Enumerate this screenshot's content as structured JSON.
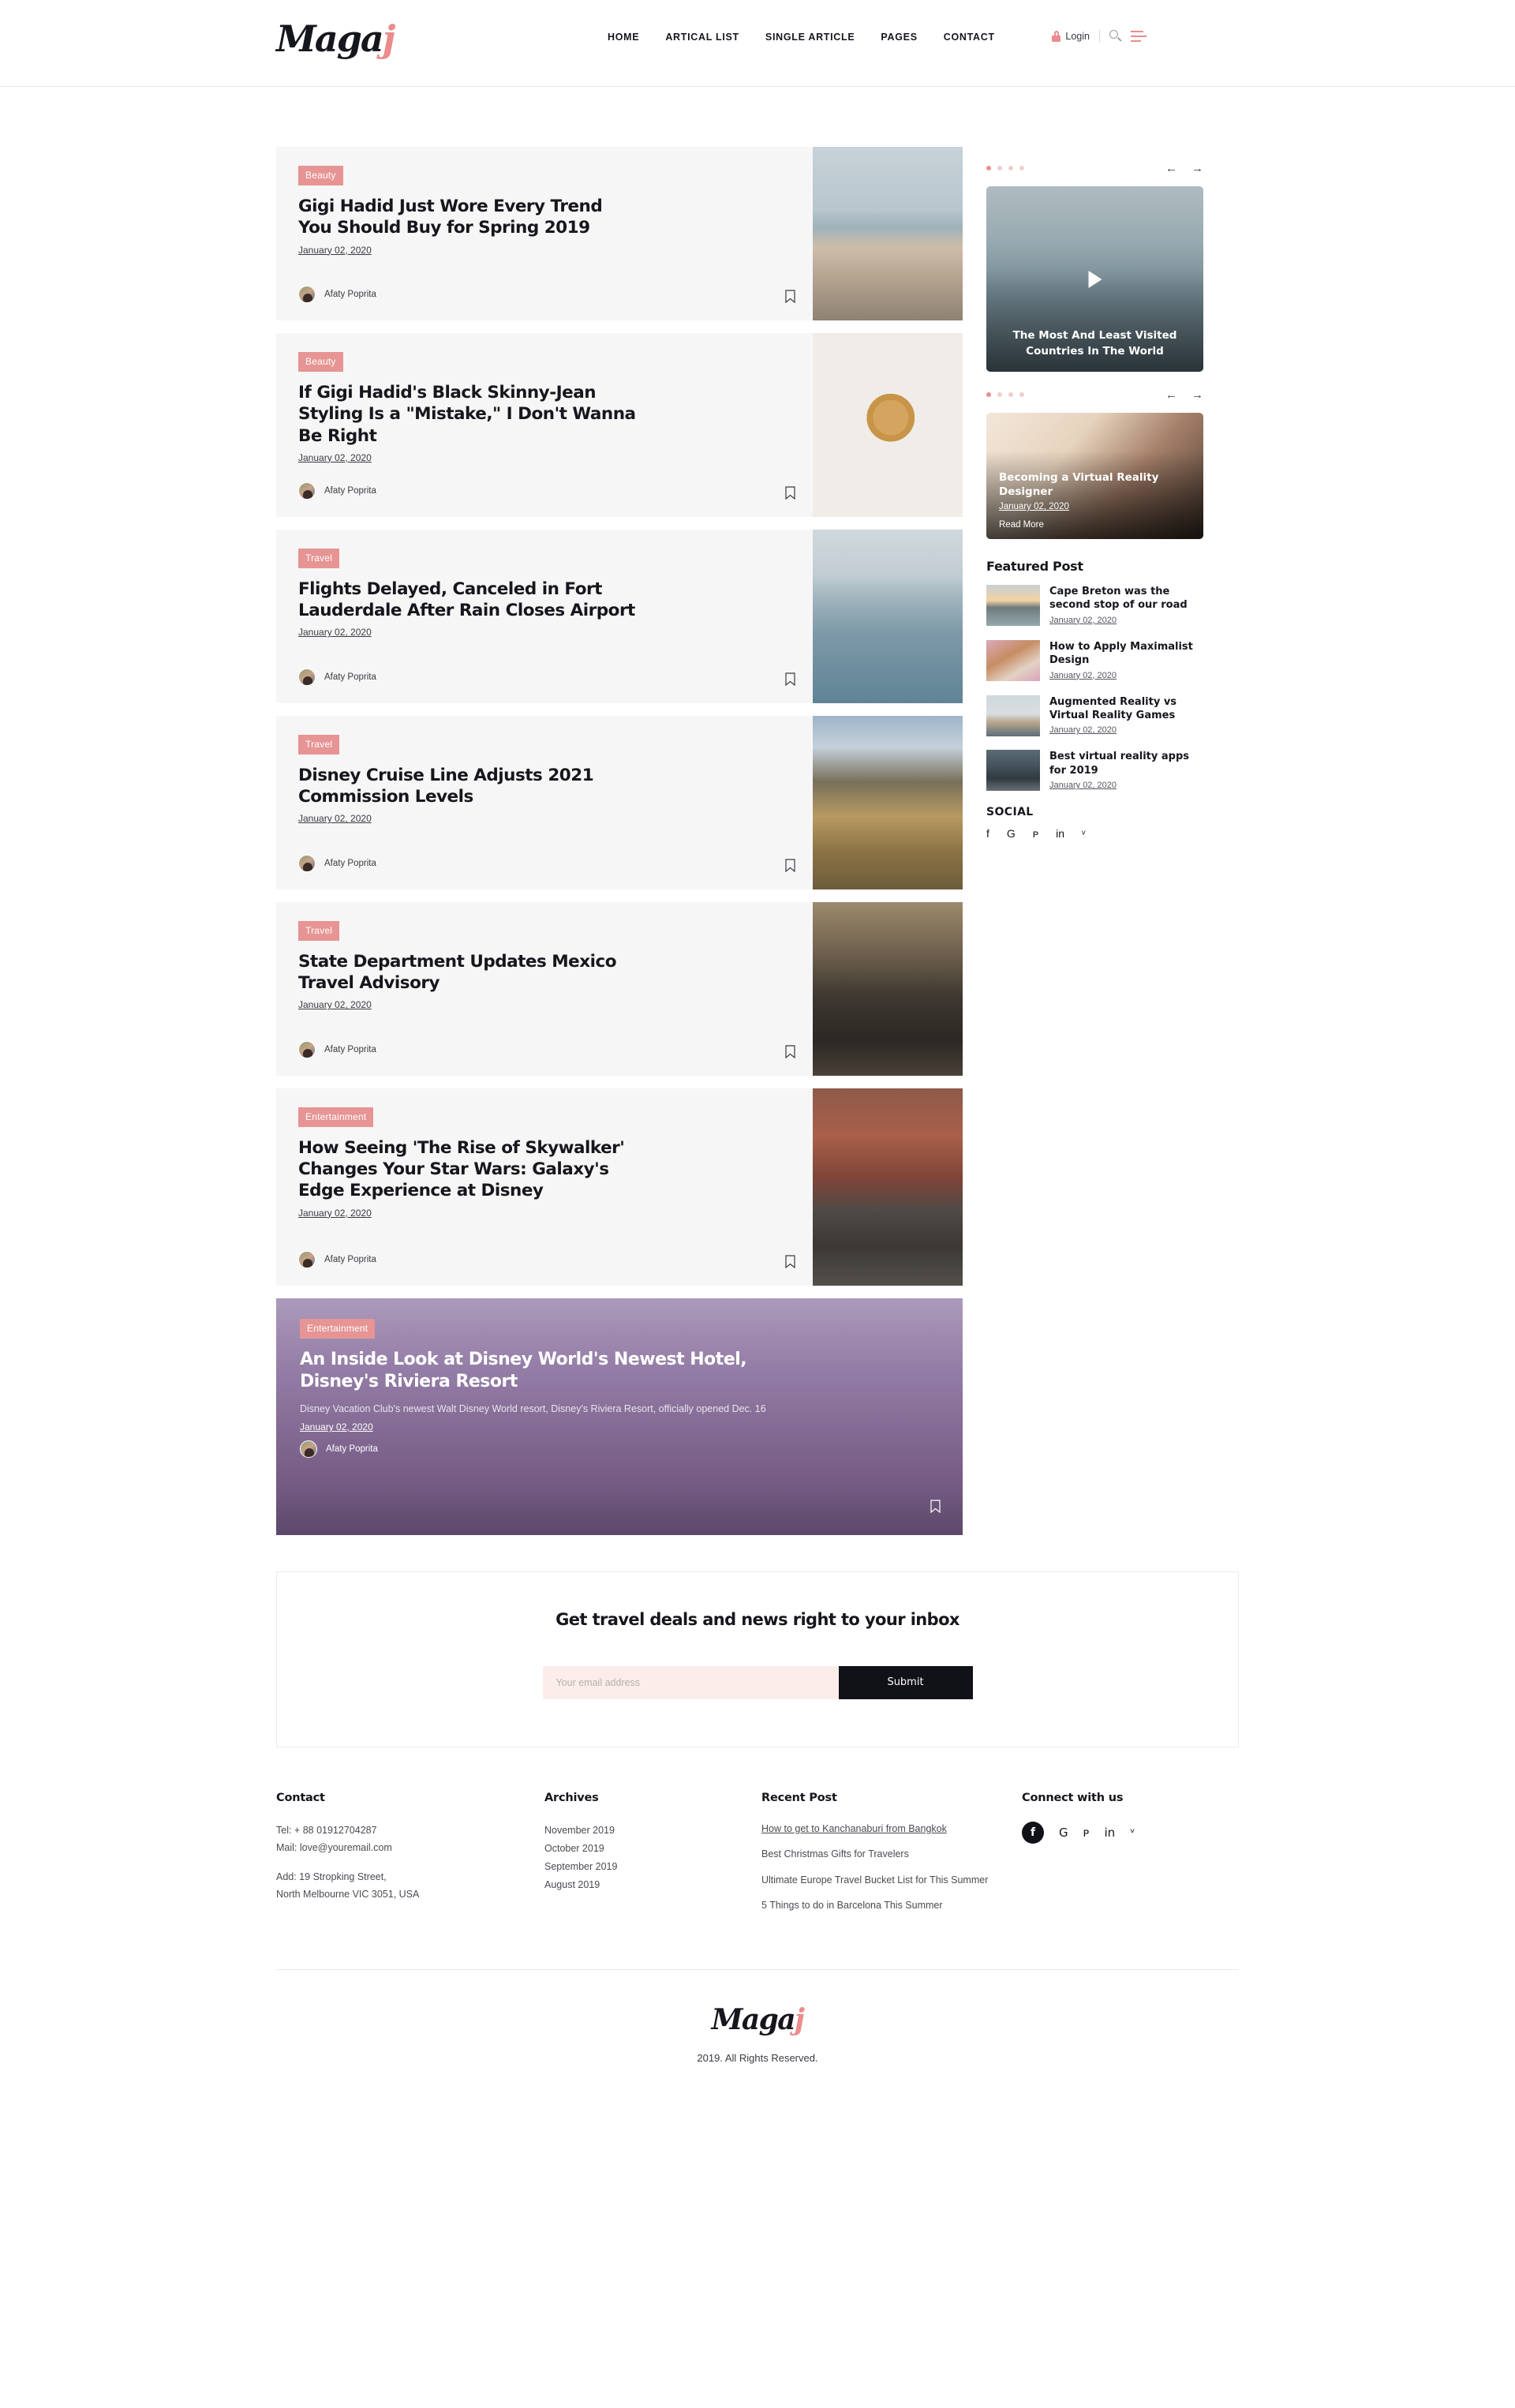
{
  "header": {
    "brand_main": "Maga",
    "brand_accent": "j",
    "nav": [
      {
        "label": "HOME"
      },
      {
        "label": "ARTICAL LIST"
      },
      {
        "label": "SINGLE ARTICLE"
      },
      {
        "label": "PAGES"
      },
      {
        "label": "CONTACT"
      }
    ],
    "login_label": "Login",
    "lock_icon": "lock-icon",
    "search_icon": "search-icon",
    "menu_icon": "hamburger-icon"
  },
  "colors": {
    "accent": "#ec8b8b",
    "badge": "#e79494",
    "card_bg": "#f7f6f6",
    "dark": "#16161d",
    "input_bg": "#fbeeea"
  },
  "articles": [
    {
      "category": "Beauty",
      "title": "Gigi Hadid Just Wore Every Trend You Should Buy for Spring 2019",
      "date": "January 02, 2020",
      "author": "Afaty Poprita",
      "thumb_class": "ph-beach"
    },
    {
      "category": "Beauty",
      "title": "If Gigi Hadid's Black Skinny-Jean Styling Is a \"Mistake,\" I Don't Wanna Be Right",
      "date": "January 02, 2020",
      "author": "Afaty Poprita",
      "thumb_class": "ph-coffee"
    },
    {
      "category": "Travel",
      "title": "Flights Delayed, Canceled in Fort Lauderdale After Rain Closes Airport",
      "date": "January 02, 2020",
      "author": "Afaty Poprita",
      "thumb_class": "ph-port"
    },
    {
      "category": "Travel",
      "title": "Disney Cruise Line Adjusts 2021 Commission Levels",
      "date": "January 02, 2020",
      "author": "Afaty Poprita",
      "thumb_class": "ph-hiker"
    },
    {
      "category": "Travel",
      "title": "State Department Updates Mexico Travel Advisory",
      "date": "January 02, 2020",
      "author": "Afaty Poprita",
      "thumb_class": "ph-couple"
    },
    {
      "category": "Entertainment",
      "title": "How Seeing 'The Rise of Skywalker' Changes Your Star Wars: Galaxy's Edge Experience at Disney",
      "date": "January 02, 2020",
      "author": "Afaty Poprita",
      "thumb_class": "ph-road"
    }
  ],
  "hero": {
    "category": "Entertainment",
    "title": "An Inside Look at Disney World's Newest Hotel, Disney's Riviera Resort",
    "excerpt": "Disney Vacation Club's newest Walt Disney World resort, Disney's Riviera Resort, officially opened Dec. 16",
    "date": "January 02, 2020",
    "author": "Afaty Poprita"
  },
  "sidebar": {
    "video_slider": {
      "dots": 4,
      "active_dot": 0,
      "prev_icon": "arrow-left-icon",
      "next_icon": "arrow-right-icon",
      "play_icon": "play-icon",
      "caption": "The Most And Least Visited Countries In The World"
    },
    "post_slider": {
      "dots": 4,
      "active_dot": 0,
      "prev_icon": "arrow-left-icon",
      "next_icon": "arrow-right-icon",
      "title": "Becoming a Virtual Reality Designer",
      "date": "January 02, 2020",
      "read_more": "Read More"
    },
    "featured_heading": "Featured Post",
    "featured": [
      {
        "title": "Cape Breton was the second stop of our road",
        "date": "January 02, 2020",
        "thumb_class": "ph-cape"
      },
      {
        "title": "How to Apply Maximalist Design",
        "date": "January 02, 2020",
        "thumb_class": "ph-hair"
      },
      {
        "title": "Augmented Reality vs Virtual Reality Games",
        "date": "January 02, 2020",
        "thumb_class": "ph-girl"
      },
      {
        "title": "Best virtual reality apps for 2019",
        "date": "January 02, 2020",
        "thumb_class": "ph-mountain"
      }
    ],
    "social_heading": "SOCIAL",
    "social": [
      {
        "icon": "facebook-icon",
        "glyph": "f"
      },
      {
        "icon": "google-icon",
        "glyph": "G"
      },
      {
        "icon": "pinterest-icon",
        "glyph": "ᴘ"
      },
      {
        "icon": "linkedin-icon",
        "glyph": "in"
      },
      {
        "icon": "twitter-icon",
        "glyph": "ᵛ"
      }
    ]
  },
  "newsletter": {
    "title": "Get travel deals and news right to your inbox",
    "placeholder": "Your email address",
    "value": "",
    "submit_label": "Submit"
  },
  "footer": {
    "contact": {
      "heading": "Contact",
      "tel": "Tel: + 88 01912704287",
      "mail": "Mail: love@youremail.com",
      "addr1": "Add: 19 Stropking Street,",
      "addr2": "North Melbourne VIC 3051, USA"
    },
    "archives": {
      "heading": "Archives",
      "items": [
        "November 2019",
        "October 2019",
        "September 2019",
        "August 2019"
      ]
    },
    "recent": {
      "heading": "Recent Post",
      "items": [
        "How to get to Kanchanaburi from Bangkok",
        "Best Christmas Gifts for Travelers",
        "Ultimate Europe Travel Bucket List for This Summer",
        "5 Things to do in Barcelona This Summer"
      ]
    },
    "connect": {
      "heading": "Connect with us",
      "social": [
        {
          "icon": "facebook-icon",
          "glyph": "f"
        },
        {
          "icon": "google-icon",
          "glyph": "G"
        },
        {
          "icon": "pinterest-icon",
          "glyph": "ᴘ"
        },
        {
          "icon": "linkedin-icon",
          "glyph": "in"
        },
        {
          "icon": "twitter-icon",
          "glyph": "ᵛ"
        }
      ]
    },
    "brand_main": "Maga",
    "brand_accent": "j",
    "copyright": "2019. All Rights Reserved."
  }
}
